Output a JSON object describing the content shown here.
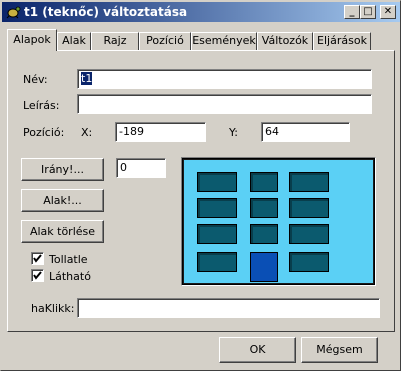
{
  "window": {
    "title": "t1 (teknőc) változtatása",
    "buttons": {
      "minimize": "_",
      "maximize": "□",
      "close": "✕"
    }
  },
  "tabs": [
    {
      "label": "Alapok",
      "active": true
    },
    {
      "label": "Alak"
    },
    {
      "label": "Rajz"
    },
    {
      "label": "Pozíció"
    },
    {
      "label": "Események"
    },
    {
      "label": "Változók"
    },
    {
      "label": "Eljárások"
    }
  ],
  "form": {
    "name_label": "Név:",
    "name_value": "t1",
    "desc_label": "Leírás:",
    "desc_value": "",
    "position_label": "Pozíció:",
    "x_label": "X:",
    "x_value": "-189",
    "y_label": "Y:",
    "y_value": "64",
    "direction_button": "Irány!...",
    "direction_value": "0",
    "shape_button": "Alak!...",
    "delete_shape_button": "Alak törlése",
    "solid_label": "Tollatle",
    "solid_checked": true,
    "visible_label": "Látható",
    "visible_checked": true,
    "onclick_label": "haKlikk:",
    "onclick_value": ""
  },
  "footer": {
    "ok_label": "OK",
    "cancel_label": "Mégsem"
  },
  "colors": {
    "title_start": "#0a246a",
    "title_end": "#a6caf0",
    "preview_bg": "#5bd0f5",
    "window_tile": "#0b5a6e",
    "door": "#0a4fb5"
  }
}
